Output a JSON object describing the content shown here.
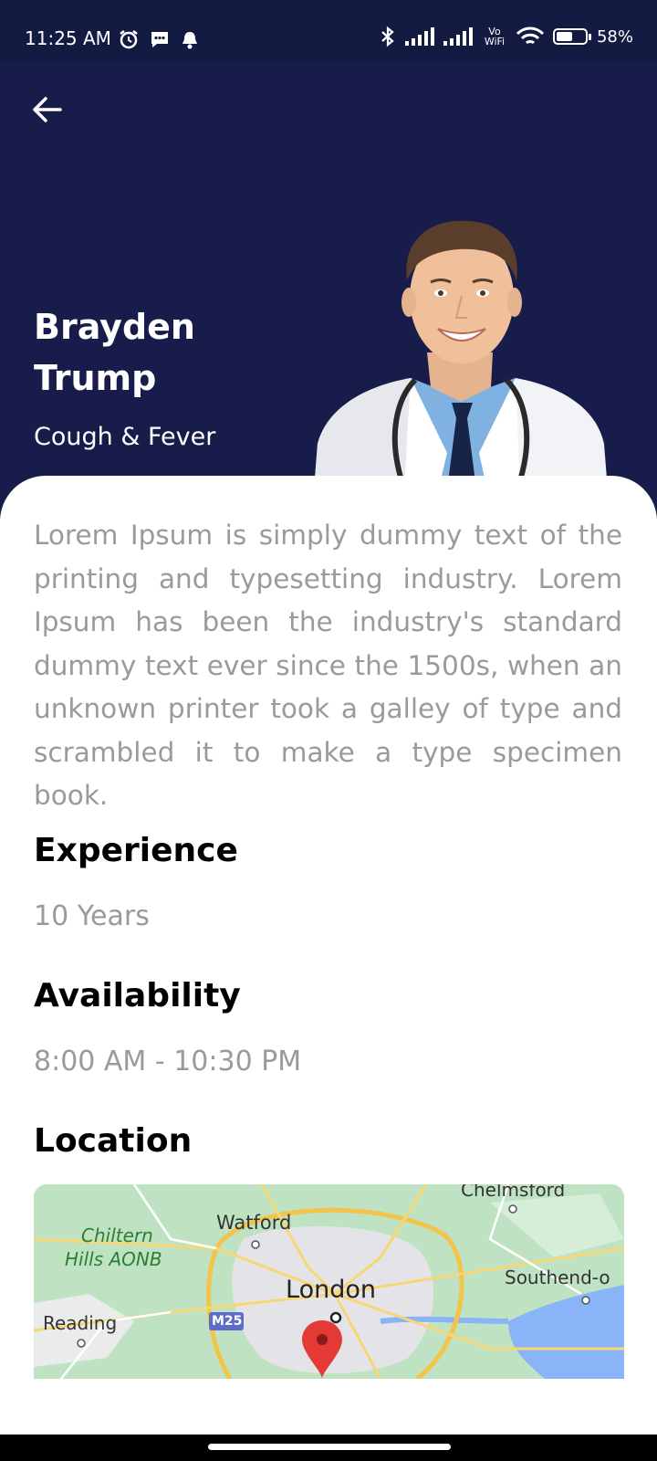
{
  "status_bar": {
    "time": "11:25 AM",
    "battery_percent": "58%",
    "battery_level": 0.58,
    "network_label": "Vo WiFi",
    "icons_left": [
      "alarm-icon",
      "message-icon",
      "bell-icon"
    ],
    "icons_right": [
      "bluetooth-icon",
      "signal-icon",
      "signal-icon",
      "wifi-icon",
      "battery-icon"
    ]
  },
  "header": {
    "background": "#171c4a",
    "back_icon": "back-arrow-icon",
    "doctor_name": "Brayden Trump",
    "specialty": "Cough & Fever"
  },
  "details": {
    "description": "Lorem Ipsum is simply dummy text of the printing and typesetting industry. Lorem Ipsum has been the industry's standard dummy text ever since the 1500s, when an unknown printer took a galley of type and scrambled it to make a type specimen book.",
    "experience_title": "Experience",
    "experience_value": "10 Years",
    "availability_title": "Availability",
    "availability_value": "8:00 AM - 10:30 PM",
    "location_title": "Location"
  },
  "map": {
    "labels": {
      "chelmsford": "Chelmsford",
      "chiltern": "Chiltern",
      "hills": "Hills AONB",
      "watford": "Watford",
      "london": "London",
      "southend": "Southend-o",
      "reading": "Reading",
      "m25": "M25"
    },
    "marker_color": "#e53935"
  }
}
